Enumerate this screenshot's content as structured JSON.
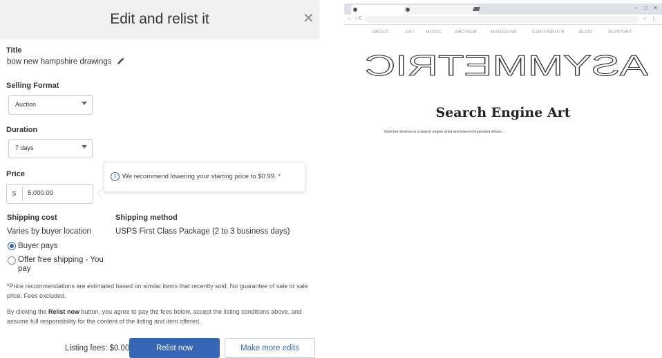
{
  "dialog": {
    "title": "Edit and relist it",
    "close_glyph": "✕",
    "title_section": {
      "label": "Title",
      "value": "bow new hampshire  drawings"
    },
    "selling_format": {
      "label": "Selling Format",
      "selected": "Auction"
    },
    "duration": {
      "label": "Duration",
      "selected": "7 days"
    },
    "price": {
      "label": "Price",
      "currency": "$",
      "value": "5,000.00"
    },
    "tip": {
      "text": "We recommend lowering your starting price to $0.99. *",
      "icon": "info-icon"
    },
    "shipping_cost": {
      "label": "Shipping cost",
      "value": "Varies by buyer location",
      "options": [
        "Buyer pays",
        "Offer free shipping - You pay"
      ],
      "selected_index": 0
    },
    "shipping_method": {
      "label": "Shipping method",
      "value": "USPS First Class Package (2 to 3 business days)"
    },
    "disclaimer": "*Price recommendations are estimated based on similar items that recently sold. No guarantee of sale or sale price. Fees excluded.",
    "agreement": {
      "prefix": "By clicking the ",
      "bold": "Relist now",
      "suffix": " button, you agree to pay the fees below, accept the listing conditions above, and assume full responsibility for the content of the listing and item offered."
    },
    "listing_fees": "Listing fees: $0.00",
    "relist_button": "Relist now",
    "more_edits_button": "Make more edits"
  },
  "browser": {
    "nav": [
      "ABOUT",
      "ART",
      "MUSIC",
      "ARCHIVE",
      "MAGAZINE",
      "CONTRIBUTE",
      "BLOG",
      "SUPPORT"
    ],
    "logo_text": "ASYMMETRIC",
    "heading": "Search Engine Art",
    "paragraph": "Gretchen Andrew is a search engine artist and internet imperialist whose ...",
    "colors": {
      "tabbar": "#dee1e6",
      "heading": "#222222"
    }
  },
  "colors": {
    "accent": "#3665b3",
    "header_bg": "#f0f0f0"
  }
}
